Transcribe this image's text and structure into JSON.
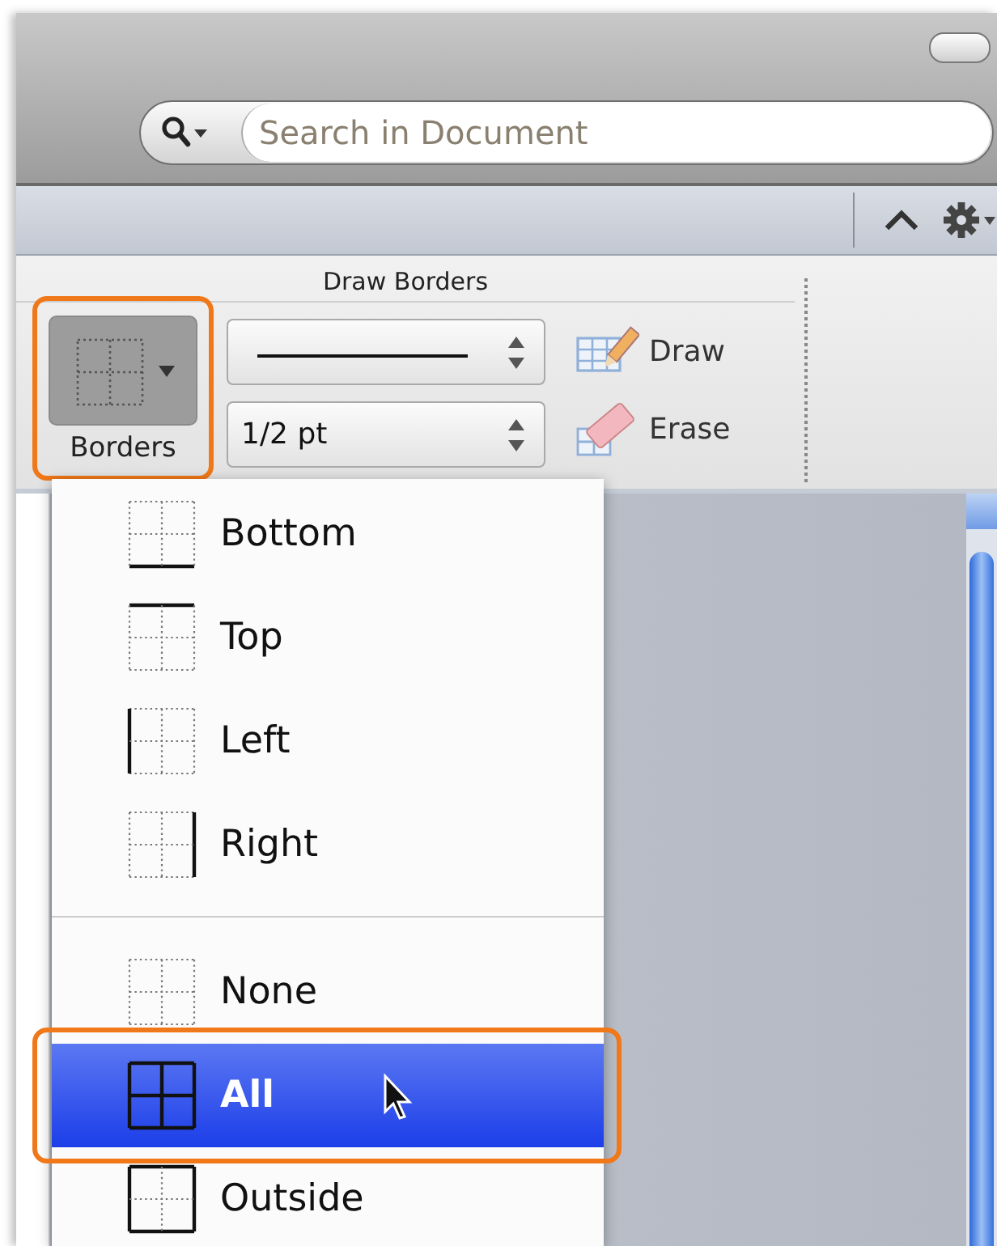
{
  "search": {
    "placeholder": "Search in Document"
  },
  "ribbon": {
    "group_title": "Draw Borders",
    "borders_button": {
      "label": "Borders",
      "callout": true
    },
    "line_style": {
      "kind": "line"
    },
    "line_weight": {
      "value": "1/2 pt"
    },
    "tools": [
      {
        "kind": "draw",
        "label": "Draw"
      },
      {
        "kind": "erase",
        "label": "Erase"
      }
    ]
  },
  "menu": {
    "groups": [
      {
        "items": [
          {
            "label": "Bottom",
            "kind": "bottom",
            "selected": false,
            "callout": false
          },
          {
            "label": "Top",
            "kind": "top",
            "selected": false,
            "callout": false
          },
          {
            "label": "Left",
            "kind": "left",
            "selected": false,
            "callout": false
          },
          {
            "label": "Right",
            "kind": "right",
            "selected": false,
            "callout": false
          }
        ]
      },
      {
        "items": [
          {
            "label": "None",
            "kind": "none",
            "selected": false,
            "callout": false
          },
          {
            "label": "All",
            "kind": "all",
            "selected": true,
            "callout": true
          },
          {
            "label": "Outside",
            "kind": "outside",
            "selected": false,
            "callout": false
          }
        ]
      }
    ]
  }
}
